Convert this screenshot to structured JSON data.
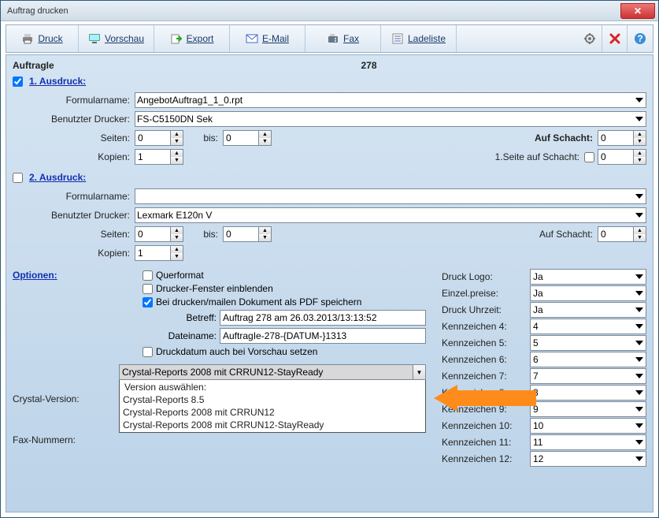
{
  "window": {
    "title": "Auftrag drucken"
  },
  "toolbar": {
    "druck": "Druck",
    "vorschau": "Vorschau",
    "export": "Export",
    "email": "E-Mail",
    "fax": "Fax",
    "ladeliste": "Ladeliste"
  },
  "header": {
    "left": "AuftragIe",
    "right": "278"
  },
  "print1": {
    "title": "1. Ausdruck:",
    "checked": true,
    "form_label": "Formularname:",
    "form_value": "AngebotAuftrag1_1_0.rpt",
    "printer_label": "Benutzter Drucker:",
    "printer_value": "FS-C5150DN Sek",
    "seiten_label": "Seiten:",
    "seiten_from": "0",
    "bis_label": "bis:",
    "seiten_to": "0",
    "schacht_label": "Auf Schacht:",
    "schacht_val": "0",
    "kopien_label": "Kopien:",
    "kopien_val": "1",
    "seite1_label": "1.Seite auf Schacht:",
    "seite1_val": "0"
  },
  "print2": {
    "title": "2. Ausdruck:",
    "checked": false,
    "form_label": "Formularname:",
    "form_value": "",
    "printer_label": "Benutzter Drucker:",
    "printer_value": "Lexmark E120n V",
    "seiten_label": "Seiten:",
    "seiten_from": "0",
    "bis_label": "bis:",
    "seiten_to": "0",
    "schacht_label": "Auf Schacht:",
    "schacht_val": "0",
    "kopien_label": "Kopien:",
    "kopien_val": "1"
  },
  "options": {
    "title": "Optionen:",
    "querformat": "Querformat",
    "drucker_fenster": "Drucker-Fenster einblenden",
    "pdf_speichern": "Bei drucken/mailen Dokument als PDF speichern",
    "betreff_label": "Betreff:",
    "betreff_value": "Auftrag 278 am 26.03.2013/13:13:52",
    "dateiname_label": "Dateiname:",
    "dateiname_value": "AuftragIe-278-{DATUM-}1313",
    "druckdatum": "Druckdatum auch bei Vorschau setzen",
    "crystal_label": "Crystal-Version:",
    "crystal_value": "Crystal-Reports 2008 mit CRRUN12-StayReady",
    "crystal_list_header": "Version auswählen:",
    "crystal_opts": [
      "Crystal-Reports 8.5",
      "Crystal-Reports 2008 mit CRRUN12",
      "Crystal-Reports 2008 mit CRRUN12-StayReady"
    ],
    "fax_label": "Fax-Nummern:"
  },
  "kennzeichen": {
    "logo_label": "Druck Logo:",
    "logo_val": "Ja",
    "preise_label": "Einzel.preise:",
    "preise_val": "Ja",
    "uhrzeit_label": "Druck Uhrzeit:",
    "uhrzeit_val": "Ja",
    "kz": [
      {
        "label": "Kennzeichen 4:",
        "val": "4"
      },
      {
        "label": "Kennzeichen 5:",
        "val": "5"
      },
      {
        "label": "Kennzeichen 6:",
        "val": "6"
      },
      {
        "label": "Kennzeichen 7:",
        "val": "7"
      },
      {
        "label": "Kennzeichen 8:",
        "val": "8"
      },
      {
        "label": "Kennzeichen 9:",
        "val": "9"
      },
      {
        "label": "Kennzeichen 10:",
        "val": "10"
      },
      {
        "label": "Kennzeichen 11:",
        "val": "11"
      },
      {
        "label": "Kennzeichen 12:",
        "val": "12"
      }
    ]
  }
}
